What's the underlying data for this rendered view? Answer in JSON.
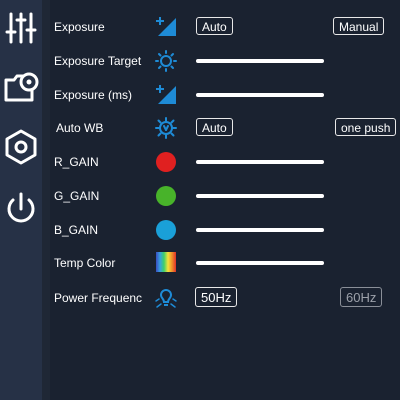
{
  "sidebar": {
    "items": [
      {
        "icon": "sliders-icon"
      },
      {
        "icon": "camera-settings-icon"
      },
      {
        "icon": "hexagon-settings-icon"
      },
      {
        "icon": "power-icon"
      }
    ]
  },
  "rows": {
    "exposure": {
      "label": "Exposure",
      "icon": "exposure-icon",
      "auto_label": "Auto",
      "manual_label": "Manual"
    },
    "exposure_target": {
      "label": "Exposure Target",
      "icon": "brightness-icon"
    },
    "exposure_ms": {
      "label": "Exposure (ms)",
      "icon": "exposure-icon"
    },
    "auto_wb": {
      "label": "Auto WB",
      "icon": "white-balance-icon",
      "auto_label": "Auto",
      "onepush_label": "one push"
    },
    "r_gain": {
      "label": "R_GAIN",
      "color": "#e02020"
    },
    "g_gain": {
      "label": "G_GAIN",
      "color": "#48b32a"
    },
    "b_gain": {
      "label": "B_GAIN",
      "color": "#1aa0d8"
    },
    "temp_color": {
      "label": "Temp Color",
      "icon": "rainbow-icon"
    },
    "power_frequency": {
      "label": "Power Frequenc",
      "icon": "flicker-icon",
      "hz50_label": "50Hz",
      "hz60_label": "60Hz"
    }
  }
}
